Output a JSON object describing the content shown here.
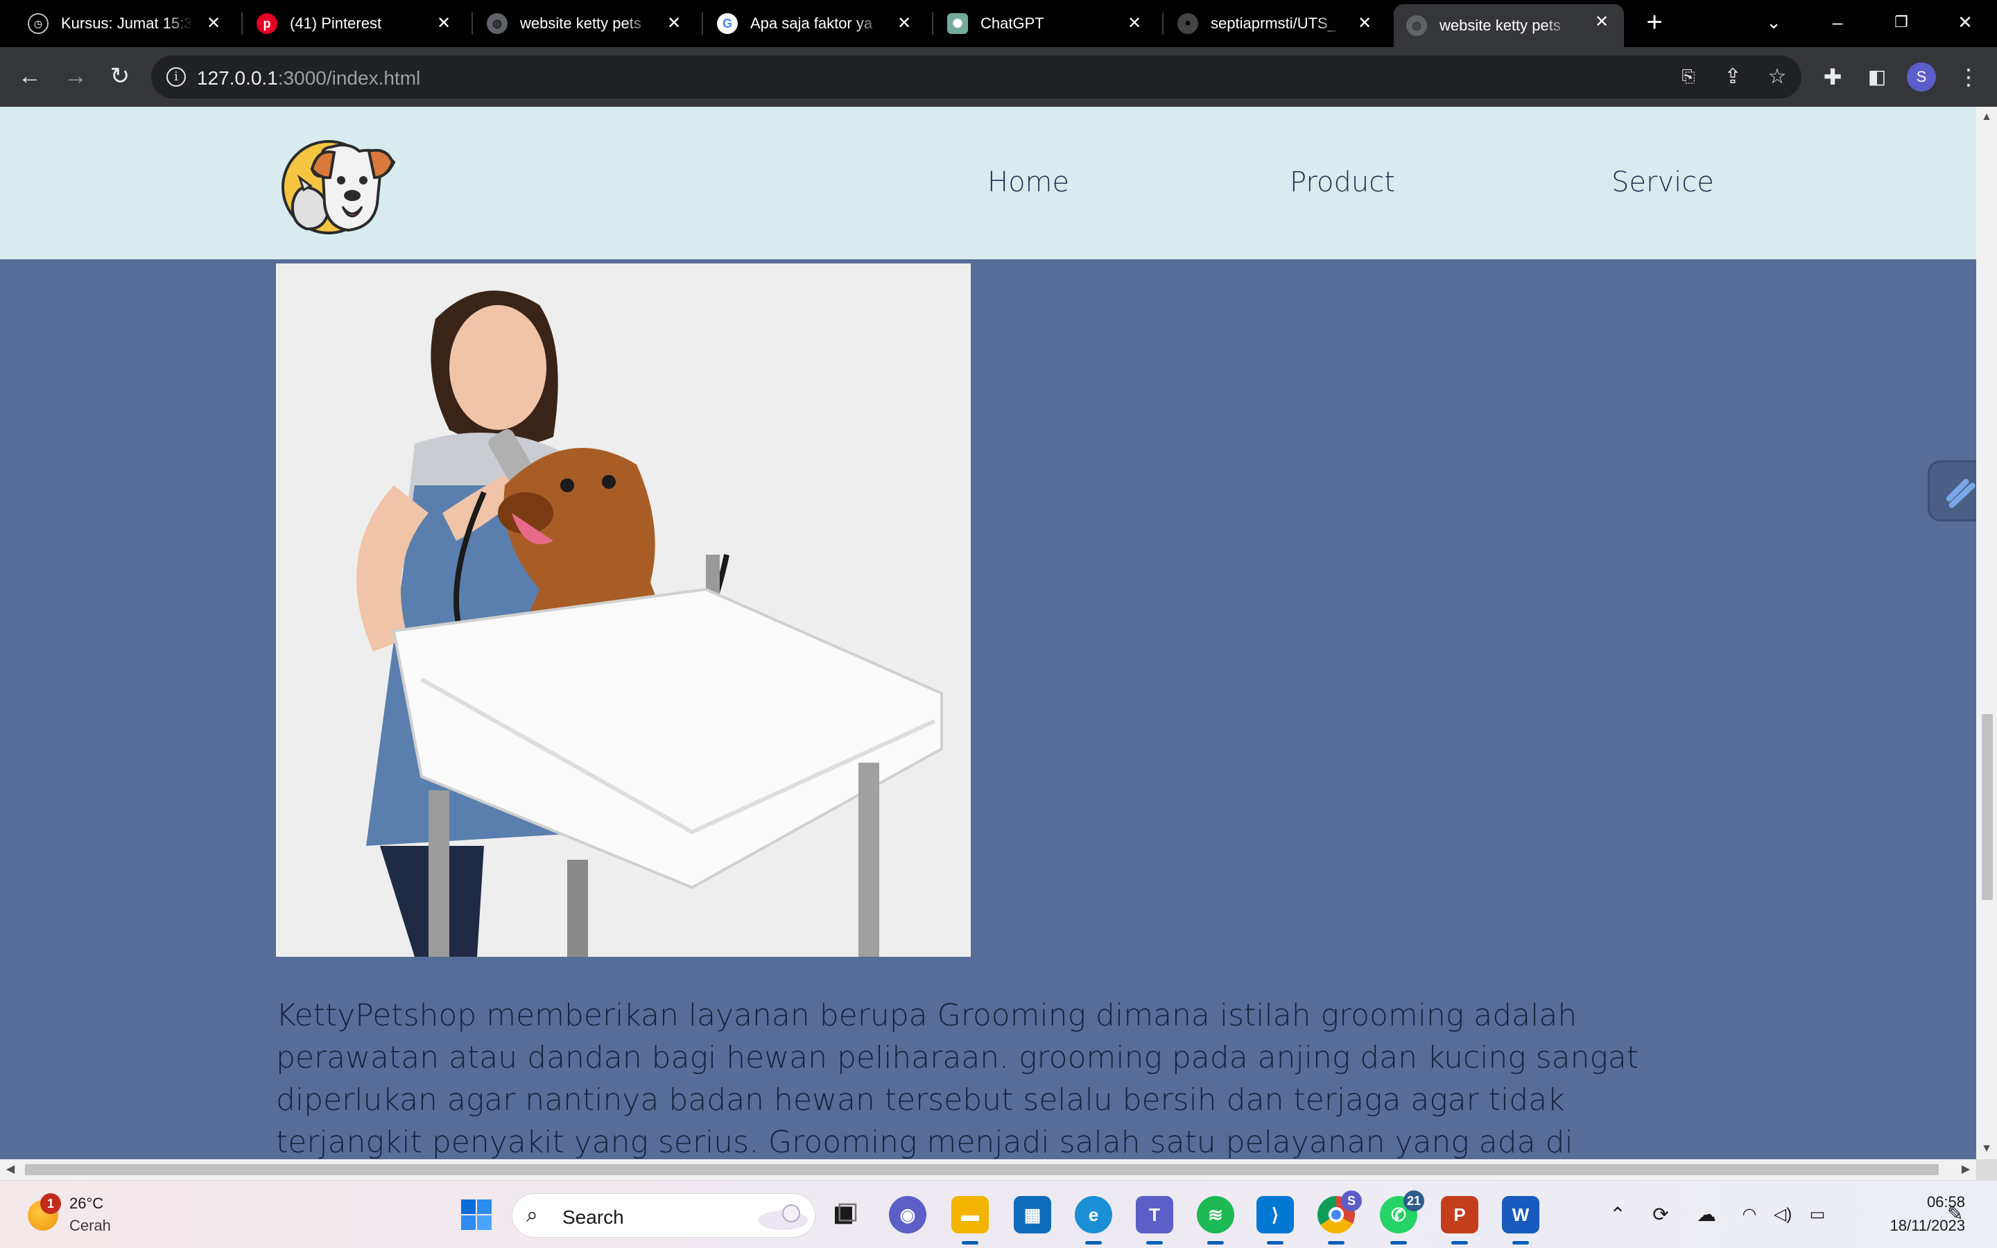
{
  "browser": {
    "tabs": [
      {
        "title": "Kursus: Jumat 15:3",
        "icon": "moodle-icon",
        "active": false
      },
      {
        "title": "(41) Pinterest",
        "icon": "pinterest-icon",
        "active": false
      },
      {
        "title": "website ketty pets",
        "icon": "globe-icon",
        "active": false
      },
      {
        "title": "Apa saja faktor ya",
        "icon": "google-icon",
        "active": false
      },
      {
        "title": "ChatGPT",
        "icon": "chatgpt-icon",
        "active": false
      },
      {
        "title": "septiaprmsti/UTS_",
        "icon": "github-icon",
        "active": false
      },
      {
        "title": "website ketty pets",
        "icon": "globe-icon",
        "active": true
      }
    ],
    "url_host": "127.0.0.1",
    "url_rest": ":3000/index.html",
    "profile_initial": "S"
  },
  "site": {
    "nav": {
      "home": "Home",
      "product": "Product",
      "service": "Service"
    },
    "service_paragraph": "KettyPetshop memberikan layanan berupa Grooming dimana istilah grooming adalah perawatan atau dandan bagi hewan peliharaan. grooming pada anjing dan kucing sangat diperlukan agar nantinya badan hewan tersebut selalu bersih dan terjaga agar tidak terjangkit penyakit yang serius. Grooming menjadi salah satu pelayanan yang ada di KettyPetshop",
    "colors": {
      "header_bg": "#d8ecf0",
      "page_bg": "#566d98",
      "text": "#15233b"
    }
  },
  "taskbar": {
    "weather": {
      "badge": "1",
      "temp": "26°C",
      "desc": "Cerah"
    },
    "search_label": "Search",
    "whatsapp_badge": "21",
    "chrome_badge": "S",
    "clock": {
      "time": "06:58",
      "date": "18/11/2023"
    }
  }
}
